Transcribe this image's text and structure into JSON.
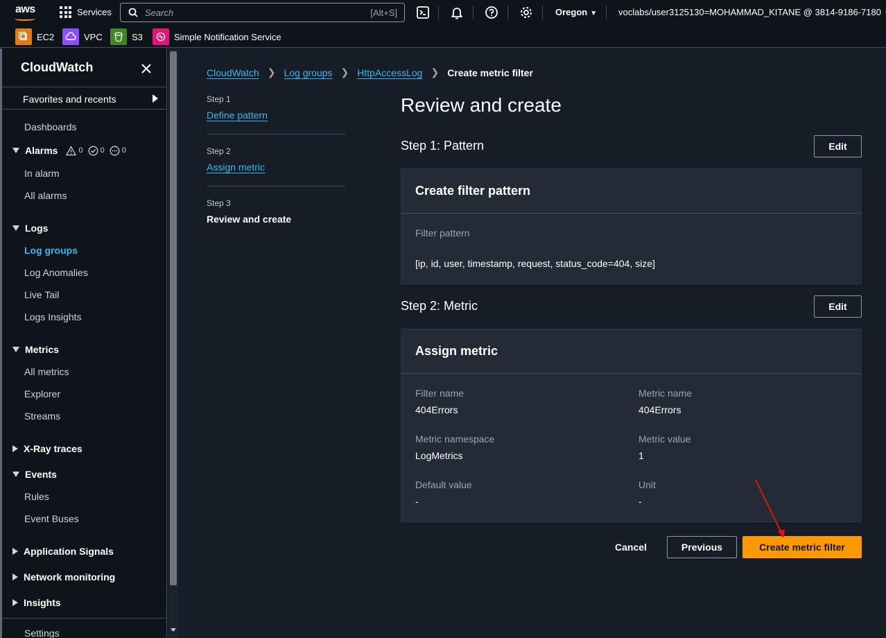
{
  "topnav": {
    "logo_text": "aws",
    "services_label": "Services",
    "search_placeholder": "Search",
    "search_shortcut": "[Alt+S]",
    "region": "Oregon",
    "account": "voclabs/user3125130=MOHAMMAD_KITANE @ 3814-9186-7180",
    "icons": [
      "cloudshell-icon",
      "notifications-bell-icon",
      "help-icon",
      "settings-gear-icon"
    ]
  },
  "favorites": [
    {
      "label": "EC2",
      "color": "#e07b16"
    },
    {
      "label": "VPC",
      "color": "#8c4fff"
    },
    {
      "label": "S3",
      "color": "#3f8624"
    },
    {
      "label": "Simple Notification Service",
      "color": "#e7157b"
    }
  ],
  "sidebar": {
    "title": "CloudWatch",
    "favorites_recents": "Favorites and recents",
    "dashboards": "Dashboards",
    "alarms": {
      "label": "Alarms",
      "in_alarm_count": "0",
      "ok_count": "0",
      "insufficient_count": "0"
    },
    "in_alarm": "In alarm",
    "all_alarms": "All alarms",
    "logs": "Logs",
    "log_groups": "Log groups",
    "log_anomalies": "Log Anomalies",
    "live_tail": "Live Tail",
    "logs_insights": "Logs Insights",
    "metrics": "Metrics",
    "all_metrics": "All metrics",
    "explorer": "Explorer",
    "streams": "Streams",
    "xray": "X-Ray traces",
    "events": "Events",
    "rules": "Rules",
    "event_buses": "Event Buses",
    "app_signals": "Application Signals",
    "network_monitoring": "Network monitoring",
    "insights": "Insights",
    "settings": "Settings"
  },
  "breadcrumbs": {
    "cloudwatch": "CloudWatch",
    "log_groups": "Log groups",
    "log_group": "HttpAccessLog",
    "current": "Create metric filter"
  },
  "steps": [
    {
      "step": "Step 1",
      "label": "Define pattern"
    },
    {
      "step": "Step 2",
      "label": "Assign metric"
    },
    {
      "step": "Step 3",
      "label": "Review and create"
    }
  ],
  "page_title": "Review and create",
  "section1": {
    "heading": "Step 1: Pattern",
    "edit": "Edit",
    "panel_title": "Create filter pattern",
    "filter_pattern_label": "Filter pattern",
    "filter_pattern_value": "[ip, id, user, timestamp, request, status_code=404, size]"
  },
  "section2": {
    "heading": "Step 2: Metric",
    "edit": "Edit",
    "panel_title": "Assign metric",
    "filter_name_label": "Filter name",
    "filter_name_value": "404Errors",
    "metric_name_label": "Metric name",
    "metric_name_value": "404Errors",
    "metric_namespace_label": "Metric namespace",
    "metric_namespace_value": "LogMetrics",
    "metric_value_label": "Metric value",
    "metric_value_value": "1",
    "default_value_label": "Default value",
    "default_value_value": "-",
    "unit_label": "Unit",
    "unit_value": "-"
  },
  "actions": {
    "cancel": "Cancel",
    "previous": "Previous",
    "create": "Create metric filter"
  },
  "colors": {
    "accent_orange": "#ff9900",
    "link_blue": "#33b8f0",
    "annotation_red": "#e0120b"
  }
}
